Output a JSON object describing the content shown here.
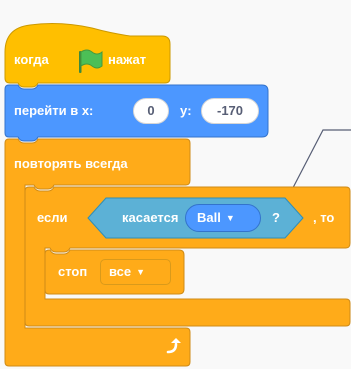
{
  "colors": {
    "events": "#ffbf00",
    "motion": "#4c97ff",
    "control": "#ffab19",
    "sensing": "#5cb1d6",
    "flag": "#4cbf56",
    "background": "#f9f9f9"
  },
  "when_flag": {
    "text_before": "когда",
    "flag_icon": "green-flag-icon",
    "text_after": "нажат"
  },
  "goto": {
    "label": "перейти в x:",
    "x_value": "0",
    "y_label": "y:",
    "y_value": "-170"
  },
  "forever": {
    "label": "повторять всегда",
    "loop_icon": "loop-arrow-icon"
  },
  "if_block": {
    "if_label": "если",
    "then_label": ", то",
    "sensing": {
      "label": "касается",
      "target": "Ball",
      "question": "?"
    }
  },
  "stop": {
    "label": "стоп",
    "option": "все"
  }
}
